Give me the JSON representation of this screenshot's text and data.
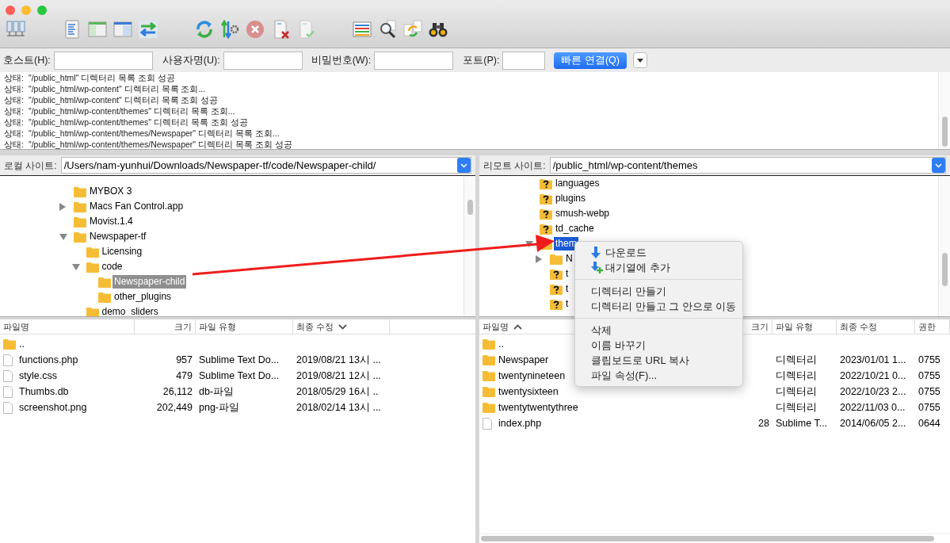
{
  "quickconnect": {
    "fields": [
      {
        "label": "호스트(H):"
      },
      {
        "label": "사용자명(U):"
      },
      {
        "label": "비밀번호(W):"
      },
      {
        "label": "포트(P):"
      }
    ],
    "button": "빠른 연결(Q)"
  },
  "log": [
    {
      "label": "상태:",
      "message": "\"/public_html\" 디렉터리 목록 조회 성공"
    },
    {
      "label": "상태:",
      "message": "\"/public_html/wp-content\" 디렉터리 목록 조회..."
    },
    {
      "label": "상태:",
      "message": "\"/public_html/wp-content\" 디렉터리 목록 조회 성공"
    },
    {
      "label": "상태:",
      "message": "\"/public_html/wp-content/themes\" 디렉터리 목록 조회..."
    },
    {
      "label": "상태:",
      "message": "\"/public_html/wp-content/themes\" 디렉터리 목록 조회 성공"
    },
    {
      "label": "상태:",
      "message": "\"/public_html/wp-content/themes/Newspaper\" 디렉터리 목록 조회..."
    },
    {
      "label": "상태:",
      "message": "\"/public_html/wp-content/themes/Newspaper\" 디렉터리 목록 조회 성공"
    }
  ],
  "local": {
    "site_label": "로컬 사이트:",
    "path": "/Users/nam-yunhui/Downloads/Newspaper-tf/code/Newspaper-child/",
    "active": false,
    "tree": [
      {
        "name": "MYBOX 3",
        "kind": "folder",
        "selected": false
      },
      {
        "name": "Macs Fan Control.app",
        "kind": "folder",
        "selected": false,
        "expanded": false
      },
      {
        "name": "Movist.1.4",
        "kind": "folder",
        "selected": false
      },
      {
        "name": "Newspaper-tf",
        "kind": "folder",
        "selected": false,
        "expanded": true,
        "children": [
          {
            "name": "Licensing",
            "kind": "folder",
            "selected": false
          },
          {
            "name": "code",
            "kind": "folder",
            "selected": false,
            "expanded": true,
            "children": [
              {
                "name": "Newspaper-child",
                "kind": "folder",
                "selected": true
              },
              {
                "name": "other_plugins",
                "kind": "folder",
                "selected": false
              }
            ]
          },
          {
            "name": "demo_sliders",
            "kind": "folder",
            "selected": false
          }
        ]
      }
    ],
    "columns": [
      {
        "label": "파일명",
        "sorted": false
      },
      {
        "label": "크기",
        "sorted": false
      },
      {
        "label": "파일 유형",
        "sorted": false
      },
      {
        "label": "최종 수정",
        "sorted": true,
        "ascending": false
      }
    ],
    "files": [
      {
        "kind": "folder",
        "cells": [
          ".."
        ]
      },
      {
        "kind": "file",
        "cells": [
          "functions.php",
          "957",
          "Sublime Text Do...",
          "2019/08/21 13시 ..."
        ]
      },
      {
        "kind": "file",
        "cells": [
          "style.css",
          "479",
          "Sublime Text Do...",
          "2019/08/21 12시 ..."
        ]
      },
      {
        "kind": "file",
        "cells": [
          "Thumbs.db",
          "26,112",
          "db-파일",
          "2018/05/29 16시 .."
        ]
      },
      {
        "kind": "file",
        "cells": [
          "screenshot.png",
          "202,449",
          "png-파일",
          "2018/02/14 13시 ..."
        ]
      }
    ]
  },
  "remote": {
    "site_label": "리모트 사이트:",
    "path": "/public_html/wp-content/themes",
    "active": true,
    "tree": [
      {
        "name": "languages",
        "kind": "unknown",
        "selected": false
      },
      {
        "name": "plugins",
        "kind": "unknown",
        "selected": false
      },
      {
        "name": "smush-webp",
        "kind": "unknown",
        "selected": false
      },
      {
        "name": "td_cache",
        "kind": "unknown",
        "selected": false
      },
      {
        "name": "them",
        "kind": "folder",
        "selected": true,
        "expanded": true,
        "children": [
          {
            "name": "N",
            "kind": "folder",
            "selected": false,
            "expanded": false
          },
          {
            "name": "t",
            "kind": "unknown",
            "selected": false
          },
          {
            "name": "t",
            "kind": "unknown",
            "selected": false
          },
          {
            "name": "t",
            "kind": "unknown",
            "selected": false
          }
        ]
      }
    ],
    "columns": [
      {
        "label": "파일명",
        "sorted": true,
        "ascending": true
      },
      {
        "label": "크기",
        "sorted": false
      },
      {
        "label": "파일 유형",
        "sorted": false
      },
      {
        "label": "최종 수정",
        "sorted": false
      },
      {
        "label": "권한",
        "sorted": false
      }
    ],
    "files": [
      {
        "kind": "folder",
        "cells": [
          ".."
        ]
      },
      {
        "kind": "folder",
        "cells": [
          "Newspaper",
          "",
          "디렉터리",
          "2023/01/01 1...",
          "0755"
        ]
      },
      {
        "kind": "folder",
        "cells": [
          "twentynineteen",
          "",
          "디렉터리",
          "2022/10/21 0...",
          "0755"
        ]
      },
      {
        "kind": "folder",
        "cells": [
          "twentysixteen",
          "",
          "디렉터리",
          "2022/10/23 2...",
          "0755"
        ]
      },
      {
        "kind": "folder",
        "cells": [
          "twentytwentythree",
          "",
          "디렉터리",
          "2022/11/03 0...",
          "0755"
        ]
      },
      {
        "kind": "file",
        "cells": [
          "index.php",
          "28",
          "Sublime T...",
          "2014/06/05 2...",
          "0644"
        ]
      }
    ]
  },
  "context_menu": {
    "sections": [
      [
        "다운로드",
        "대기열에 추가"
      ],
      [
        "디렉터리 만들기",
        "디렉터리 만들고 그 안으로 이동"
      ],
      [
        "삭제",
        "이름 바꾸기",
        "클립보드로 URL 복사",
        "파일 속성(F)..."
      ]
    ]
  }
}
